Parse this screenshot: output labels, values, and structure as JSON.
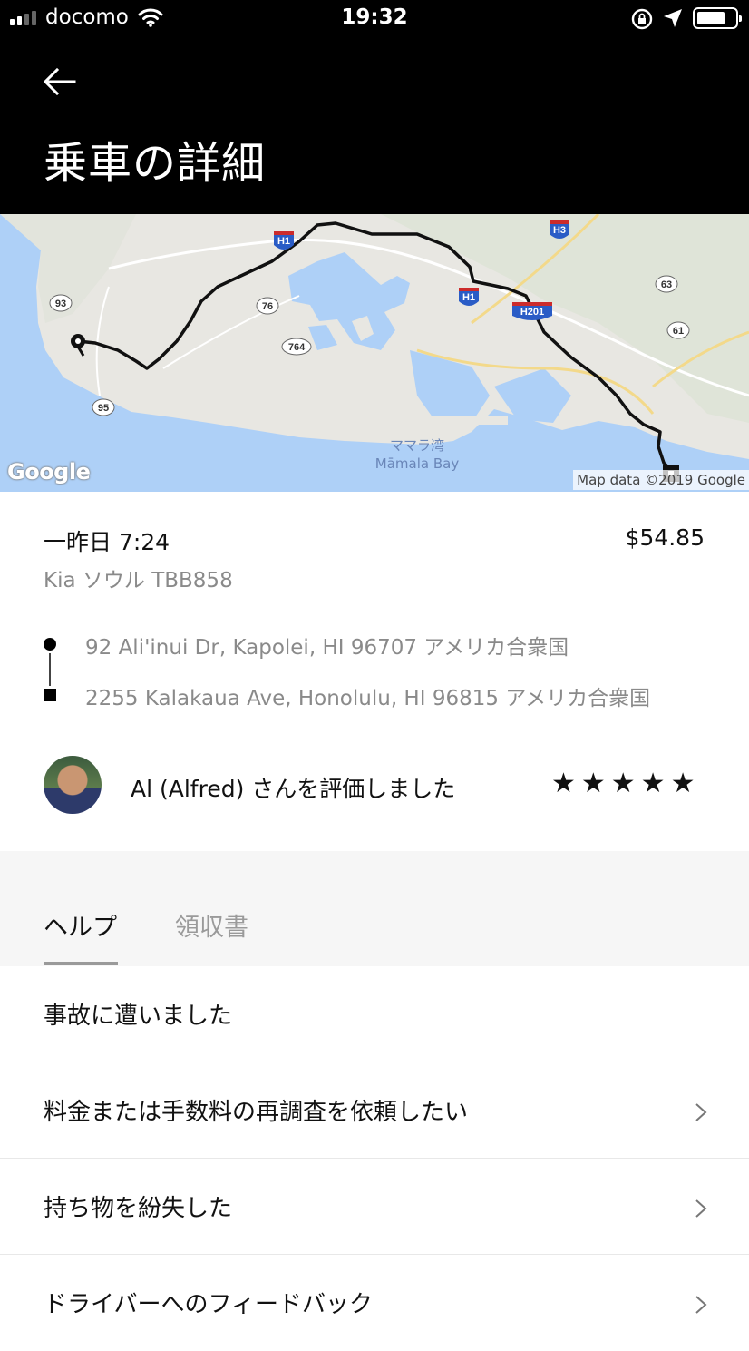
{
  "status_bar": {
    "carrier": "docomo",
    "time": "19:32",
    "battery_level": 0.75
  },
  "header": {
    "back_icon": "arrow-left-icon",
    "title": "乗車の詳細"
  },
  "map": {
    "logo_text": "Google",
    "attribution": "Map data ©2019 Google",
    "bay_label_ja": "ママラ湾",
    "bay_label_en": "Māmala Bay",
    "route_labels": [
      "H1",
      "H3",
      "H1",
      "H201",
      "93",
      "76",
      "764",
      "95",
      "63",
      "61"
    ]
  },
  "trip": {
    "datetime": "一昨日 7:24",
    "fare": "$54.85",
    "vehicle": "Kia ソウル TBB858",
    "pickup": "92 Ali'inui Dr, Kapolei, HI 96707 アメリカ合衆国",
    "dropoff": "2255 Kalakaua Ave, Honolulu, HI 96815 アメリカ合衆国",
    "rating_text": "Al (Alfred) さんを評価しました",
    "stars": "★★★★★",
    "rating_value": 5
  },
  "tabs": {
    "help": "ヘルプ",
    "receipt": "領収書"
  },
  "help_items": [
    {
      "label": "事故に遭いました",
      "chevron": false
    },
    {
      "label": "料金または手数料の再調査を依頼したい",
      "chevron": true
    },
    {
      "label": "持ち物を紛失した",
      "chevron": true
    },
    {
      "label": "ドライバーへのフィードバック",
      "chevron": true
    }
  ]
}
